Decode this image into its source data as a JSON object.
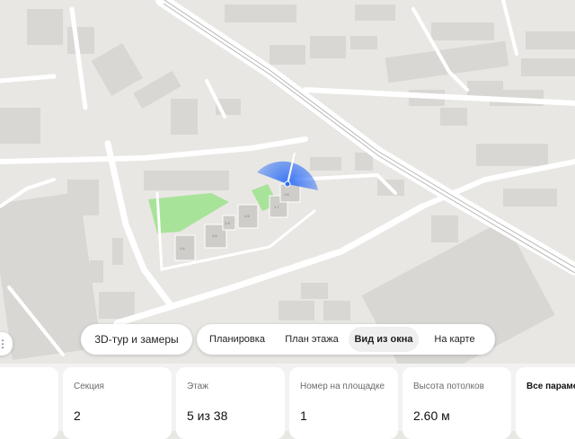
{
  "colors": {
    "map_background": "#e9e7e4",
    "building": "#d9d7d4",
    "road": "#ffffff",
    "park": "#a8e39a",
    "view_cone": "#2f6ff6"
  },
  "map": {
    "building_numbers": [
      "1.4",
      "1.5",
      "1.6",
      "1.7",
      "1.8",
      "1.9"
    ]
  },
  "nav": {
    "tour_label": "3D-тур и замеры",
    "tabs": [
      {
        "label": "Планировка",
        "active": false
      },
      {
        "label": "План этажа",
        "active": false
      },
      {
        "label": "Вид из окна",
        "active": true
      },
      {
        "label": "На карте",
        "active": false
      }
    ],
    "more_icon": "ellipsis-icon"
  },
  "params": [
    {
      "label": "Секция",
      "value": "2"
    },
    {
      "label": "Этаж",
      "value": "5 из 38"
    },
    {
      "label": "Номер на площадке",
      "value": "1"
    },
    {
      "label": "Высота потолков",
      "value": "2.60 м"
    }
  ],
  "all_params_label": "Все параметры"
}
